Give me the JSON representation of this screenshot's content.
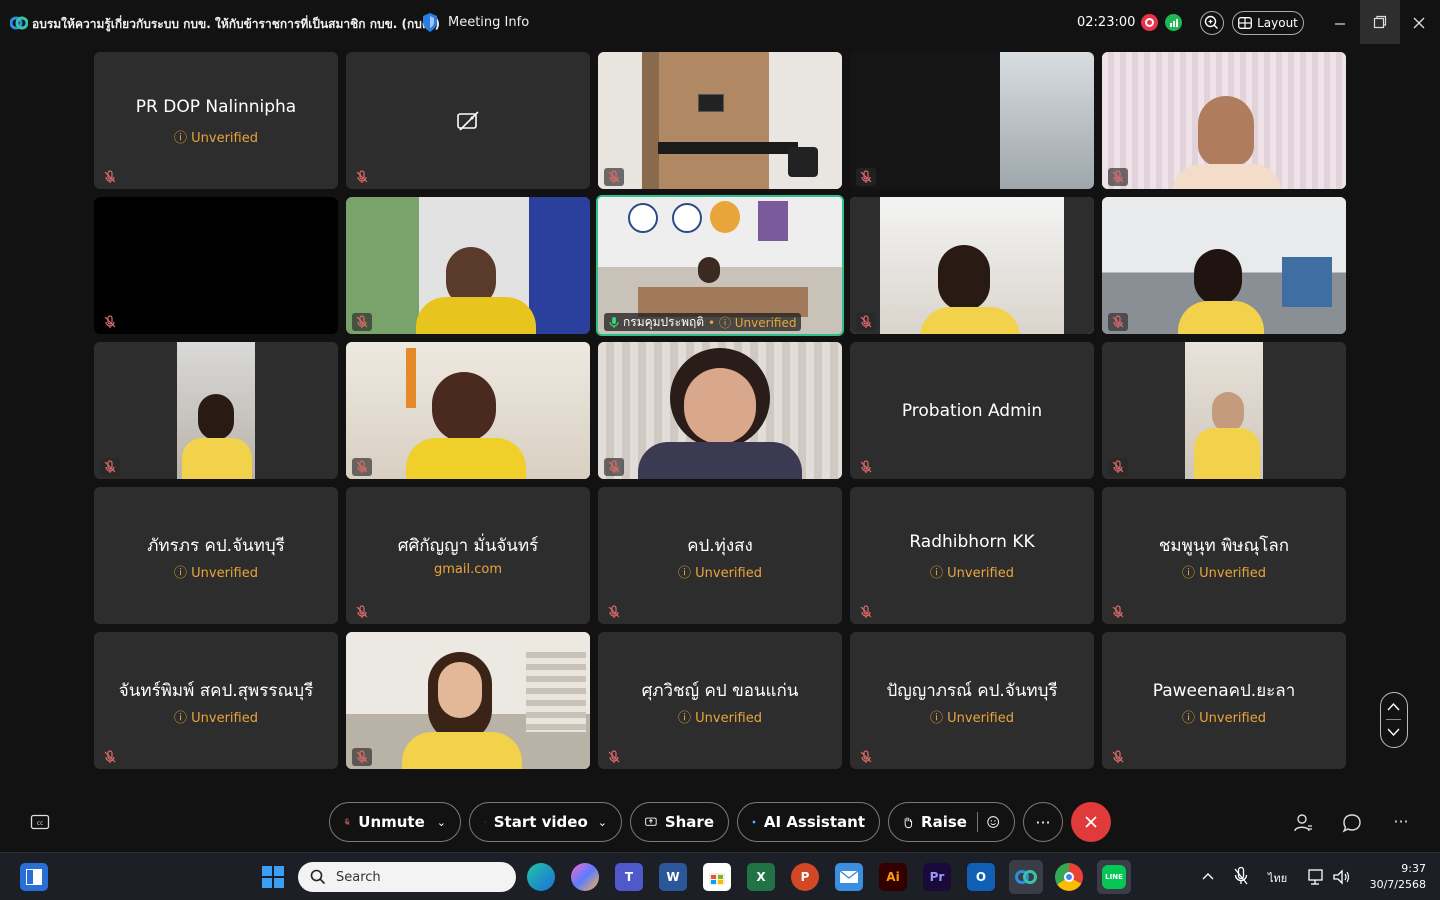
{
  "titlebar": {
    "title": "อบรมให้ความรู้เกี่ยวกับระบบ กบข. ให้กับข้าราชการที่เป็นสมาชิก กบข. (กบค.)",
    "meeting_info": "Meeting Info",
    "timer": "02:23:00",
    "layout_label": "Layout"
  },
  "tiles": [
    {
      "name": "PR DOP Nalinnipha",
      "sub": "Unverified"
    },
    {
      "name": "",
      "sub": ""
    },
    {
      "name": "",
      "sub": ""
    },
    {
      "name": "",
      "sub": ""
    },
    {
      "name": "",
      "sub": ""
    },
    {
      "name": "",
      "sub": ""
    },
    {
      "name": "",
      "sub": ""
    },
    {
      "name": "กรมคุมประพฤติ",
      "sub": "Unverified"
    },
    {
      "name": "",
      "sub": ""
    },
    {
      "name": "",
      "sub": ""
    },
    {
      "name": "",
      "sub": ""
    },
    {
      "name": "",
      "sub": ""
    },
    {
      "name": "",
      "sub": ""
    },
    {
      "name": "Probation Admin",
      "sub": ""
    },
    {
      "name": "",
      "sub": ""
    },
    {
      "name": "ภัทรภร คป.จันทบุรี",
      "sub": "Unverified"
    },
    {
      "name": "ศศิกัญญา มั่นจันทร์",
      "sub": "gmail.com"
    },
    {
      "name": "คป.ทุ่งสง",
      "sub": "Unverified"
    },
    {
      "name": "Radhibhorn KK",
      "sub": "Unverified"
    },
    {
      "name": "ชมพูนุท พิษณุโลก",
      "sub": "Unverified"
    },
    {
      "name": "จันทร์พิมพ์ สคป.สุพรรณบุรี",
      "sub": "Unverified"
    },
    {
      "name": "",
      "sub": ""
    },
    {
      "name": "ศุภวิชญ์ คป ขอนแก่น",
      "sub": "Unverified"
    },
    {
      "name": "ปัญญาภรณ์ คป.จันทบุรี",
      "sub": "Unverified"
    },
    {
      "name": "Paweenaคป.ยะลา",
      "sub": "Unverified"
    }
  ],
  "controls": {
    "unmute": "Unmute",
    "start_video": "Start video",
    "share": "Share",
    "ai_assistant": "AI Assistant",
    "raise": "Raise"
  },
  "taskbar": {
    "search_placeholder": "Search",
    "language": "ไทย",
    "time": "9:37",
    "date": "30/7/2568"
  },
  "colors": {
    "background": "#121212",
    "tile": "#2d2d2d",
    "unverified": "#e9a53b",
    "active_border": "#2fbf8f",
    "end_call": "#e03a3a"
  }
}
